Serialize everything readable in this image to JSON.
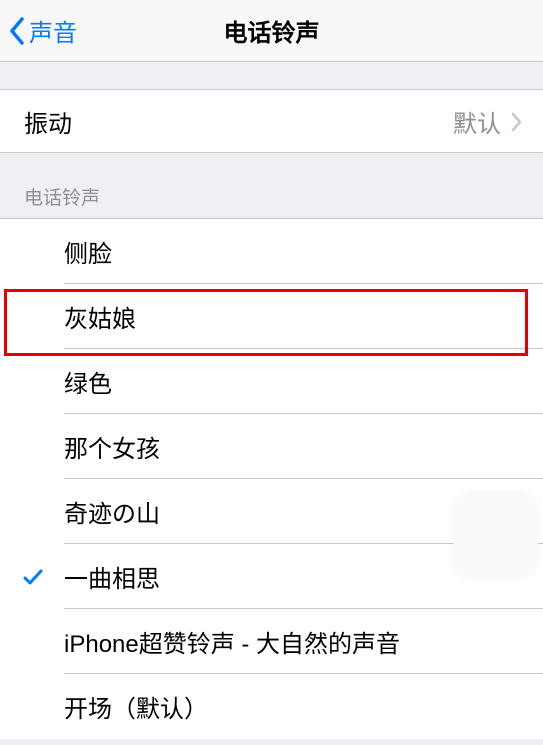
{
  "nav": {
    "back_label": "声音",
    "title": "电话铃声"
  },
  "vibration": {
    "label": "振动",
    "value": "默认"
  },
  "list_header": "电话铃声",
  "ringtones": [
    {
      "name": "侧脸",
      "selected": false
    },
    {
      "name": "灰姑娘",
      "selected": false
    },
    {
      "name": "绿色",
      "selected": false
    },
    {
      "name": "那个女孩",
      "selected": false
    },
    {
      "name": "奇迹の山",
      "selected": false
    },
    {
      "name": "一曲相思",
      "selected": true
    },
    {
      "name": "iPhone超赞铃声 - 大自然的声音",
      "selected": false
    },
    {
      "name": "开场（默认）",
      "selected": false
    }
  ]
}
